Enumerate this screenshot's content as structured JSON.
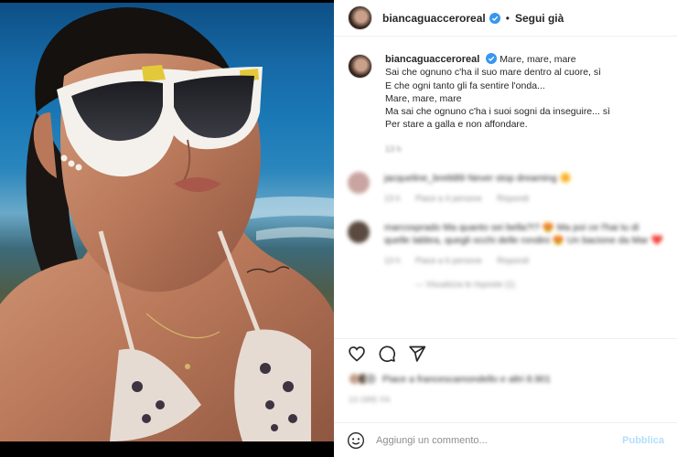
{
  "header": {
    "username": "biancaguacceroreal",
    "separator": "•",
    "follow_label": "Segui già"
  },
  "caption": {
    "username": "biancaguacceroreal",
    "lines": [
      "Mare, mare, mare",
      "Sai che ognuno c'ha il suo mare dentro al cuore, sì",
      "E che ogni tanto gli fa sentire l'onda...",
      "Mare, mare, mare",
      "Ma sai che ognuno c'ha i suoi sogni da inseguire... sì",
      "Per stare a galla e non affondare."
    ],
    "time": "13 h"
  },
  "comments": [
    {
      "text": "jacqueline_bretti89 Never stop dreaming 🌼",
      "time": "13 h",
      "likes": "Piace a 4 persone",
      "reply": "Rispondi",
      "avatar_color": "#c9a4a0"
    },
    {
      "text": "marcosprado Ma quanto sei bella?!? 😍 Ma poi ce l'hai tu di quelle labbra, quegli occhi delle rondini 😍 Un bacione da Mar ❤️",
      "time": "13 h",
      "likes": "Piace a 6 persone",
      "reply": "Rispondi",
      "view_replies": "— Visualizza le risposte (1)",
      "avatar_color": "#5a4a40"
    }
  ],
  "icons": {
    "like": "heart-icon",
    "comment": "comment-icon",
    "share": "paper-plane-icon",
    "emoji": "emoji-icon",
    "verified": "verified-badge-icon"
  },
  "likes": {
    "text": "Piace a francescamondello e altri 8.901"
  },
  "date": "13 ORE FA",
  "add_comment": {
    "placeholder": "Aggiungi un commento...",
    "publish_label": "Pubblica"
  },
  "colors": {
    "verified": "#3897f0",
    "publish_disabled": "#b2dffc",
    "muted": "#8e8e8e"
  }
}
